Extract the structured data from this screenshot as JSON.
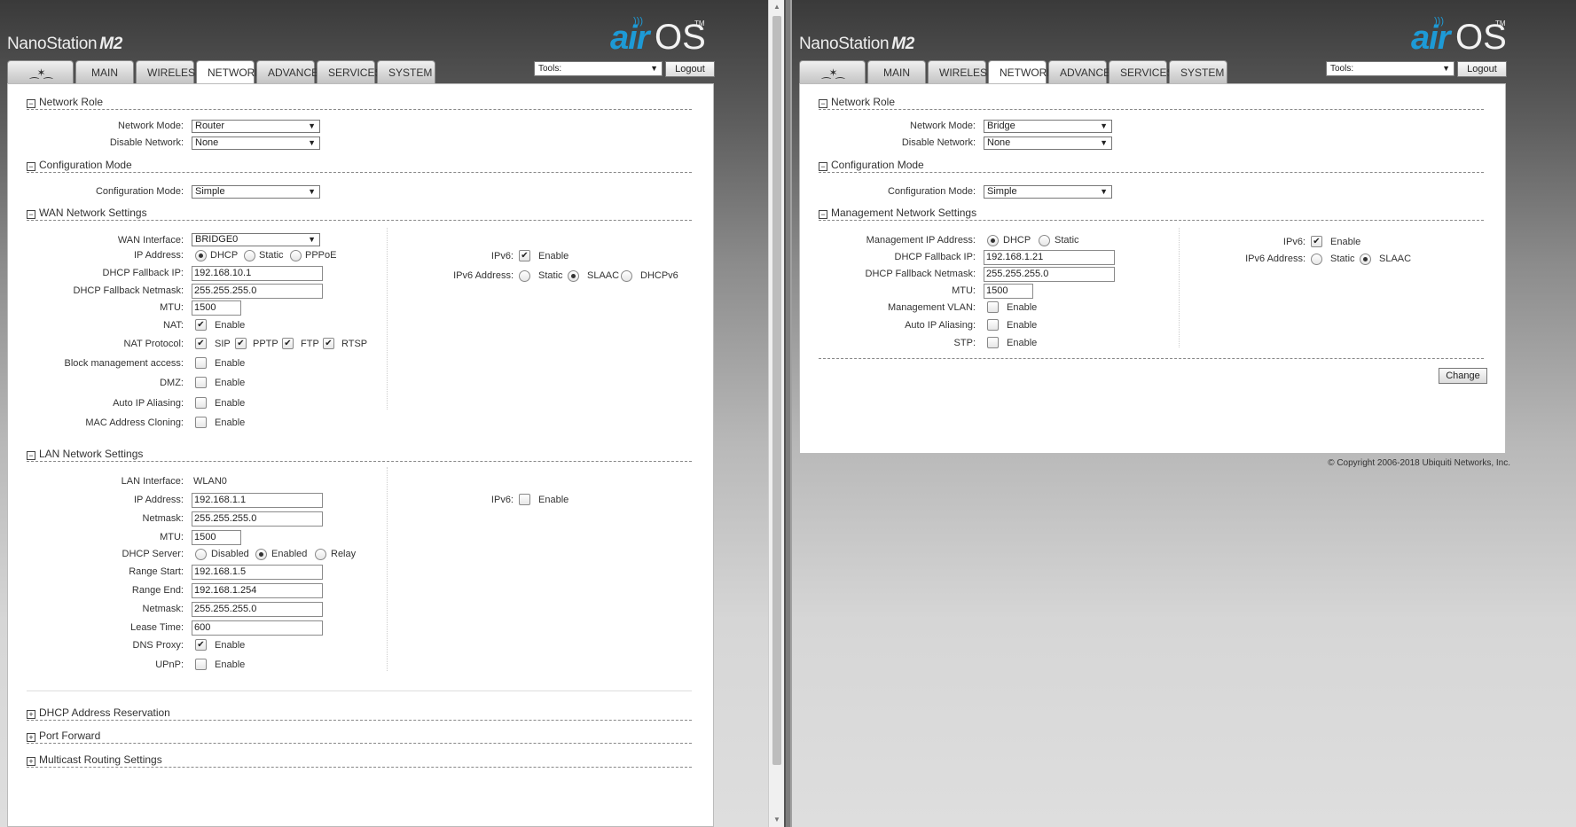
{
  "brand": {
    "name": "NanoStation",
    "model": "M2",
    "logo_air": "air",
    "logo_os": "OS",
    "logo_tm": "TM"
  },
  "tabs": [
    "MAIN",
    "WIRELESS",
    "NETWORK",
    "ADVANCED",
    "SERVICES",
    "SYSTEM"
  ],
  "active_tab": "NETWORK",
  "tools": {
    "label": "Tools:"
  },
  "logout": "Logout",
  "colors": {
    "brand_blue": "#1d9ad6",
    "header_dark": "#3a3a3a"
  },
  "left": {
    "network_role": {
      "title": "Network Role",
      "network_mode_label": "Network Mode:",
      "network_mode": "Router",
      "disable_network_label": "Disable Network:",
      "disable_network": "None"
    },
    "config_mode": {
      "title": "Configuration Mode",
      "label": "Configuration Mode:",
      "value": "Simple"
    },
    "wan": {
      "title": "WAN Network Settings",
      "wan_interface_label": "WAN Interface:",
      "wan_interface": "BRIDGE0",
      "ip_address_label": "IP Address:",
      "ip_opt1": "DHCP",
      "ip_opt2": "Static",
      "ip_opt3": "PPPoE",
      "fallback_ip_label": "DHCP Fallback IP:",
      "fallback_ip": "192.168.10.1",
      "fallback_netmask_label": "DHCP Fallback Netmask:",
      "fallback_netmask": "255.255.255.0",
      "mtu_label": "MTU:",
      "mtu": "1500",
      "nat_label": "NAT:",
      "enable": "Enable",
      "nat_protocol_label": "NAT Protocol:",
      "proto1": "SIP",
      "proto2": "PPTP",
      "proto3": "FTP",
      "proto4": "RTSP",
      "block_mgmt_label": "Block management access:",
      "dmz_label": "DMZ:",
      "auto_ip_label": "Auto IP Aliasing:",
      "mac_clone_label": "MAC Address Cloning:",
      "ipv6_label": "IPv6:",
      "ipv6_addr_label": "IPv6 Address:",
      "v6_opt1": "Static",
      "v6_opt2": "SLAAC",
      "v6_opt3": "DHCPv6"
    },
    "lan": {
      "title": "LAN Network Settings",
      "lan_interface_label": "LAN Interface:",
      "lan_interface": "WLAN0",
      "ip_address_label": "IP Address:",
      "ip_address": "192.168.1.1",
      "netmask_label": "Netmask:",
      "netmask": "255.255.255.0",
      "mtu_label": "MTU:",
      "mtu": "1500",
      "dhcp_server_label": "DHCP Server:",
      "dhcp_opt1": "Disabled",
      "dhcp_opt2": "Enabled",
      "dhcp_opt3": "Relay",
      "range_start_label": "Range Start:",
      "range_start": "192.168.1.5",
      "range_end_label": "Range End:",
      "range_end": "192.168.1.254",
      "netmask2_label": "Netmask:",
      "netmask2": "255.255.255.0",
      "lease_time_label": "Lease Time:",
      "lease_time": "600",
      "dns_proxy_label": "DNS Proxy:",
      "upnp_label": "UPnP:",
      "ipv6_label": "IPv6:",
      "enable": "Enable"
    },
    "collapsed": [
      "DHCP Address Reservation",
      "Port Forward",
      "Multicast Routing Settings"
    ]
  },
  "right": {
    "network_role": {
      "title": "Network Role",
      "network_mode_label": "Network Mode:",
      "network_mode": "Bridge",
      "disable_network_label": "Disable Network:",
      "disable_network": "None"
    },
    "config_mode": {
      "title": "Configuration Mode",
      "label": "Configuration Mode:",
      "value": "Simple"
    },
    "mgmt": {
      "title": "Management Network Settings",
      "mgmt_ip_label": "Management IP Address:",
      "ip_opt1": "DHCP",
      "ip_opt2": "Static",
      "fallback_ip_label": "DHCP Fallback IP:",
      "fallback_ip": "192.168.1.21",
      "fallback_netmask_label": "DHCP Fallback Netmask:",
      "fallback_netmask": "255.255.255.0",
      "mtu_label": "MTU:",
      "mtu": "1500",
      "vlan_label": "Management VLAN:",
      "auto_ip_label": "Auto IP Aliasing:",
      "stp_label": "STP:",
      "enable": "Enable",
      "ipv6_label": "IPv6:",
      "ipv6_addr_label": "IPv6 Address:",
      "v6_opt1": "Static",
      "v6_opt2": "SLAAC"
    },
    "change_button": "Change",
    "copyright": "© Copyright 2006-2018 Ubiquiti Networks, Inc."
  }
}
